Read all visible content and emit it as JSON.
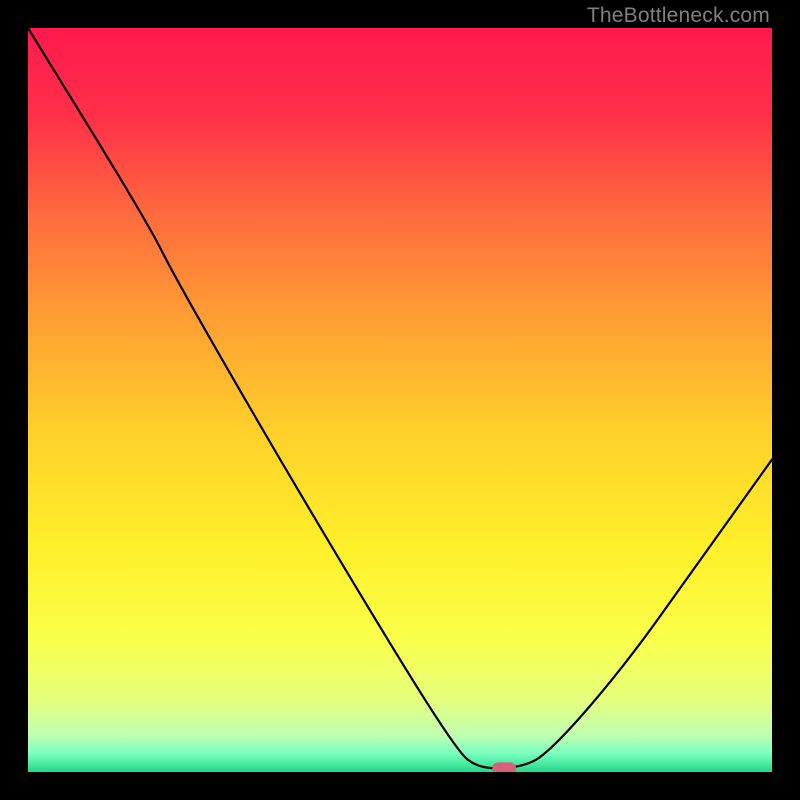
{
  "watermark": "TheBottleneck.com",
  "chart_data": {
    "type": "line",
    "title": "",
    "xlabel": "",
    "ylabel": "",
    "xlim": [
      0,
      100
    ],
    "ylim": [
      0,
      100
    ],
    "grid": false,
    "legend": false,
    "background_gradient": {
      "direction": "vertical",
      "stops": [
        {
          "pos": 0.0,
          "color": "#ff1a4d"
        },
        {
          "pos": 0.12,
          "color": "#ff3049"
        },
        {
          "pos": 0.25,
          "color": "#ff6a3e"
        },
        {
          "pos": 0.4,
          "color": "#ffa233"
        },
        {
          "pos": 0.55,
          "color": "#ffd22a"
        },
        {
          "pos": 0.7,
          "color": "#fff02a"
        },
        {
          "pos": 0.82,
          "color": "#faff4a"
        },
        {
          "pos": 0.9,
          "color": "#e6ff7a"
        },
        {
          "pos": 0.95,
          "color": "#c0ffb0"
        },
        {
          "pos": 0.975,
          "color": "#7affc0"
        },
        {
          "pos": 1.0,
          "color": "#22d98a"
        }
      ]
    },
    "series": [
      {
        "name": "bottleneck-curve",
        "stroke": "#000000",
        "stroke_width": 2.2,
        "points": [
          {
            "x": 0.0,
            "y": 100.0
          },
          {
            "x": 16.0,
            "y": 74.0
          },
          {
            "x": 20.0,
            "y": 66.0
          },
          {
            "x": 35.0,
            "y": 40.0
          },
          {
            "x": 50.0,
            "y": 15.0
          },
          {
            "x": 57.0,
            "y": 4.0
          },
          {
            "x": 60.0,
            "y": 0.5
          },
          {
            "x": 66.0,
            "y": 0.5
          },
          {
            "x": 70.0,
            "y": 2.5
          },
          {
            "x": 80.0,
            "y": 14.0
          },
          {
            "x": 90.0,
            "y": 28.0
          },
          {
            "x": 100.0,
            "y": 42.0
          }
        ]
      }
    ],
    "marker": {
      "name": "highlight-pill",
      "x": 64.0,
      "y": 0.5,
      "width": 3.2,
      "height": 1.6,
      "color": "#d9607a"
    }
  }
}
